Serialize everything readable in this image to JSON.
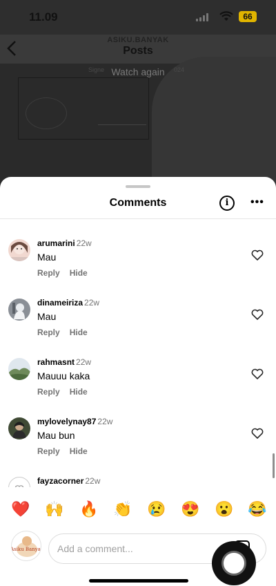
{
  "status": {
    "time": "11.09",
    "battery": "66"
  },
  "nav": {
    "username": "ASIKU.BANYAK",
    "title": "Posts"
  },
  "media": {
    "overlay_label": "Watch again",
    "faded_left": "Signe",
    "faded_right": "024"
  },
  "sheet": {
    "title": "Comments"
  },
  "comments": [
    {
      "user": "arumarini",
      "age": "22w",
      "text": "Mau",
      "reply": "Reply",
      "hide": "Hide"
    },
    {
      "user": "dinameiriza",
      "age": "22w",
      "text": "Mau",
      "reply": "Reply",
      "hide": "Hide"
    },
    {
      "user": "rahmasnt",
      "age": "22w",
      "text": "Mauuu kaka",
      "reply": "Reply",
      "hide": "Hide"
    },
    {
      "user": "mylovelynay87",
      "age": "22w",
      "text": "Mau bun",
      "reply": "Reply",
      "hide": "Hide"
    },
    {
      "user": "fayzacorner",
      "age": "22w",
      "text": "",
      "reply": "",
      "hide": ""
    }
  ],
  "reactions": [
    "❤️",
    "🙌",
    "🔥",
    "👏",
    "😢",
    "😍",
    "😮",
    "😂"
  ],
  "composer": {
    "placeholder": "Add a comment...",
    "avatar_text": "Asiku Banyak"
  },
  "colors": {
    "accent_heart": "#ed4956",
    "battery": "#e0b400",
    "muted": "#737373"
  }
}
